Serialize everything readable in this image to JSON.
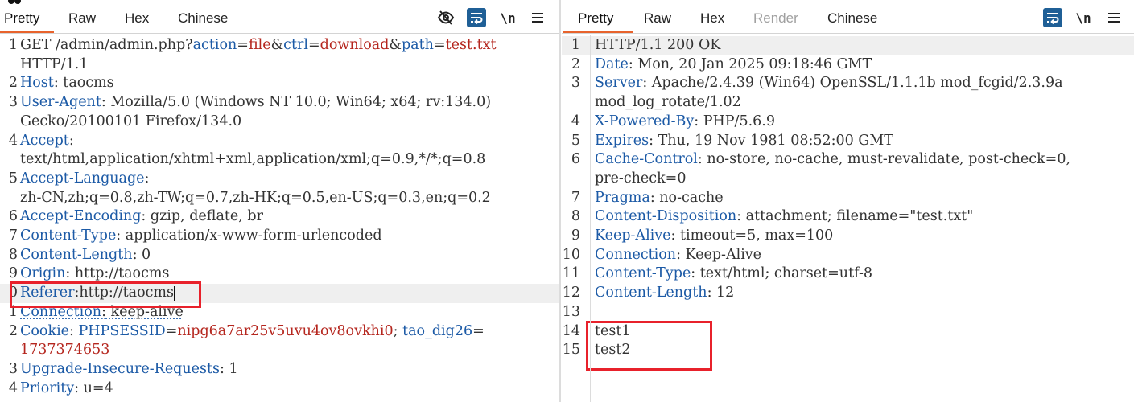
{
  "left": {
    "tabs": [
      "Pretty",
      "Raw",
      "Hex",
      "Chinese"
    ],
    "active_tab": "Pretty",
    "tools": {
      "hide_icon": "eye-off-icon",
      "wrap_icon": "wrap-icon",
      "newline_label": "\\n",
      "menu_icon": "hamburger-menu-icon"
    },
    "request_line": {
      "prefix": "GET /admin/admin.php?",
      "p1_name": "action",
      "eq": "=",
      "p1_value": "file",
      "amp": "&",
      "p2_name": "ctrl",
      "p2_value": "download",
      "p3_name": "path",
      "p3_value": "test.txt",
      "proto": "HTTP/1.1"
    },
    "headers": [
      {
        "n": "2",
        "name": "Host",
        "value": " taocms"
      },
      {
        "n": "3",
        "name": "User-Agent",
        "value": " Mozilla/5.0 (Windows NT 10.0; Win64; x64; rv:134.0)",
        "cont": "Gecko/20100101 Firefox/134.0"
      },
      {
        "n": "4",
        "name": "Accept",
        "value": "",
        "cont": "text/html,application/xhtml+xml,application/xml;q=0.9,*/*;q=0.8"
      },
      {
        "n": "5",
        "name": "Accept-Language",
        "value": "",
        "cont": "zh-CN,zh;q=0.8,zh-TW;q=0.7,zh-HK;q=0.5,en-US;q=0.3,en;q=0.2"
      },
      {
        "n": "6",
        "name": "Accept-Encoding",
        "value": " gzip, deflate, br"
      },
      {
        "n": "7",
        "name": "Content-Type",
        "value": " application/x-www-form-urlencoded"
      },
      {
        "n": "8",
        "name": "Content-Length",
        "value": " 0"
      },
      {
        "n": "9",
        "name": "Origin",
        "value": " http://taocms"
      },
      {
        "n": "0",
        "name": "Referer",
        "value": "http://taocms"
      },
      {
        "n": "1",
        "name": "Connection",
        "value": " keep-alive"
      },
      {
        "n": "2",
        "name": "Cookie",
        "cookie1_name": "PHPSESSID",
        "cookie1_value": "nipg6a7ar25v5uvu4ov8ovkhi0",
        "sep": "; ",
        "cookie2_name": "tao_dig26",
        "cookie2_value": "1737374653"
      },
      {
        "n": "3",
        "name": "Upgrade-Insecure-Requests",
        "value": " 1"
      },
      {
        "n": "4",
        "name": "Priority",
        "value": " u=4"
      }
    ],
    "first_num": "1",
    "colon": ":"
  },
  "right": {
    "tabs": [
      "Pretty",
      "Raw",
      "Hex",
      "Render",
      "Chinese"
    ],
    "active_tab": "Pretty",
    "tools": {
      "wrap_icon": "wrap-icon",
      "newline_label": "\\n",
      "menu_icon": "hamburger-menu-icon"
    },
    "status_line": "HTTP/1.1 200 OK",
    "headers": [
      {
        "n": "2",
        "name": "Date",
        "value": " Mon, 20 Jan 2025 09:18:46 GMT"
      },
      {
        "n": "3",
        "name": "Server",
        "value": " Apache/2.4.39 (Win64) OpenSSL/1.1.1b mod_fcgid/2.3.9a",
        "cont": "mod_log_rotate/1.02"
      },
      {
        "n": "4",
        "name": "X-Powered-By",
        "value": " PHP/5.6.9"
      },
      {
        "n": "5",
        "name": "Expires",
        "value": " Thu, 19 Nov 1981 08:52:00 GMT"
      },
      {
        "n": "6",
        "name": "Cache-Control",
        "value": " no-store, no-cache, must-revalidate, post-check=0,",
        "cont": " pre-check=0"
      },
      {
        "n": "7",
        "name": "Pragma",
        "value": " no-cache"
      },
      {
        "n": "8",
        "name": "Content-Disposition",
        "value": " attachment; filename=\"test.txt\""
      },
      {
        "n": "9",
        "name": "Keep-Alive",
        "value": " timeout=5, max=100"
      },
      {
        "n": "10",
        "name": "Connection",
        "value": " Keep-Alive"
      },
      {
        "n": "11",
        "name": "Content-Type",
        "value": " text/html; charset=utf-8"
      },
      {
        "n": "12",
        "name": "Content-Length",
        "value": " 12"
      }
    ],
    "blank_num": "13",
    "body_lines": [
      {
        "n": "14",
        "text": "test1"
      },
      {
        "n": "15",
        "text": "test2"
      }
    ],
    "first_num": "1",
    "colon": ":"
  },
  "colors": {
    "accent": "#e8632c",
    "key": "#1c5aa6",
    "value_red": "#b5261e",
    "highlight_box": "#e8212b",
    "tool_blue": "#1f5f96"
  }
}
